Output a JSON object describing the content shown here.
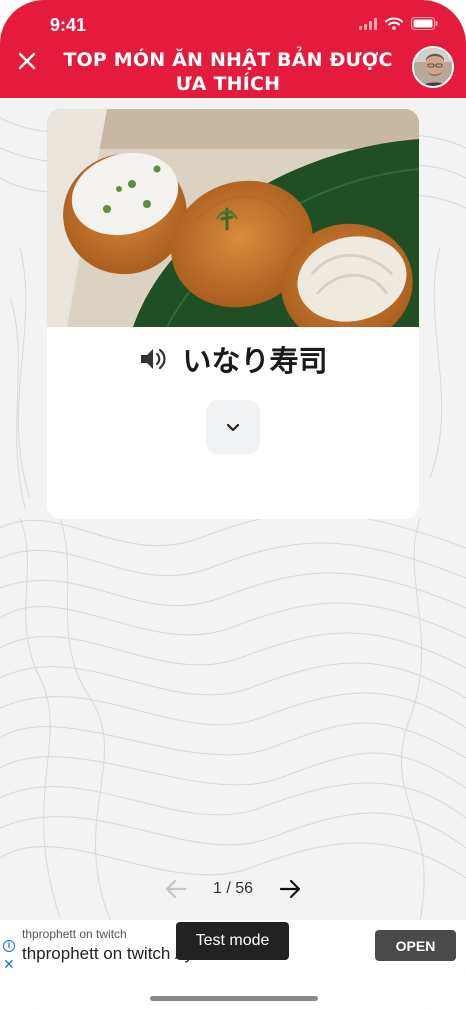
{
  "status_bar": {
    "time": "9:41"
  },
  "header": {
    "title": "TOP MÓN ĂN NHẬT BẢN ĐƯỢC ƯA THÍCH",
    "close_icon": "close-icon",
    "accent_color": "#e51b3e"
  },
  "card": {
    "word": "いなり寿司",
    "speaker_icon": "speaker-icon",
    "expand_icon": "chevron-down-icon"
  },
  "pager": {
    "count": "1 / 56",
    "prev_icon": "arrow-left-icon",
    "next_icon": "arrow-right-icon"
  },
  "ad": {
    "small_text": "thprophett on twitch",
    "big_text": "thprophett on twitch / youtube",
    "open_label": "OPEN",
    "test_mode_label": "Test mode"
  }
}
